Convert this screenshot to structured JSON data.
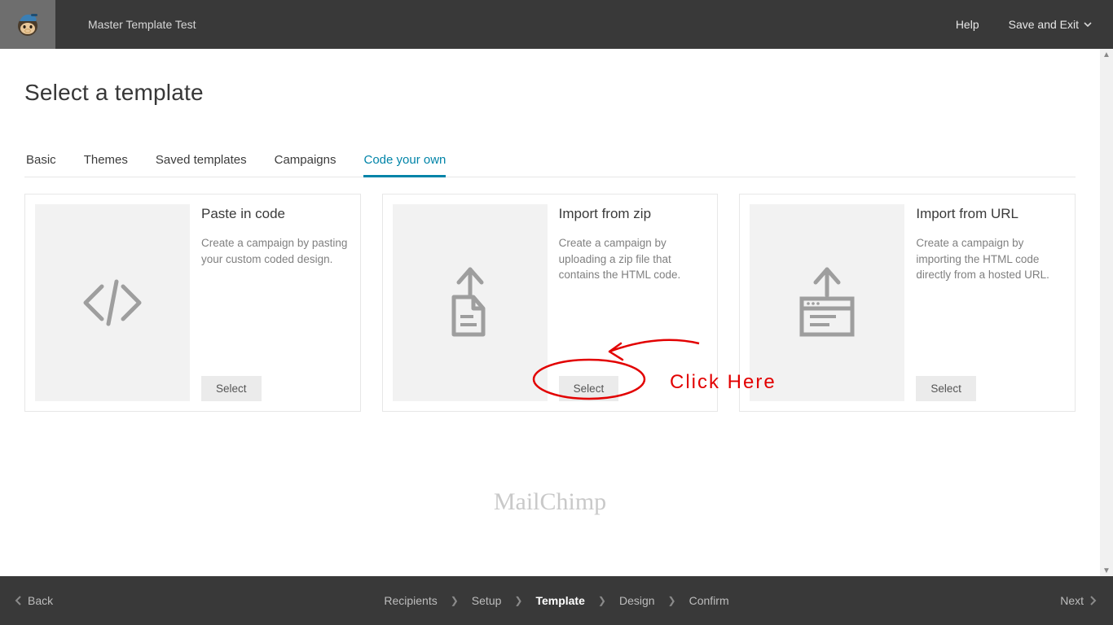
{
  "header": {
    "campaign_name": "Master Template Test",
    "help_label": "Help",
    "save_exit_label": "Save and Exit"
  },
  "page": {
    "title": "Select a template"
  },
  "tabs": [
    {
      "label": "Basic"
    },
    {
      "label": "Themes"
    },
    {
      "label": "Saved templates"
    },
    {
      "label": "Campaigns"
    },
    {
      "label": "Code your own",
      "active": true
    }
  ],
  "cards": [
    {
      "title": "Paste in code",
      "desc": "Create a campaign by pasting your custom coded design.",
      "button": "Select",
      "icon": "code"
    },
    {
      "title": "Import from zip",
      "desc": "Create a campaign by uploading a zip file that contains the HTML code.",
      "button": "Select",
      "icon": "upload-file"
    },
    {
      "title": "Import from URL",
      "desc": "Create a campaign by importing the HTML code directly from a hosted URL.",
      "button": "Select",
      "icon": "upload-browser"
    }
  ],
  "annotation": {
    "text": "Click Here"
  },
  "brand": "MailChimp",
  "footer": {
    "back": "Back",
    "next": "Next",
    "steps": [
      "Recipients",
      "Setup",
      "Template",
      "Design",
      "Confirm"
    ],
    "active_step": "Template"
  },
  "colors": {
    "accent": "#0084a8",
    "annotation": "#e20000"
  }
}
